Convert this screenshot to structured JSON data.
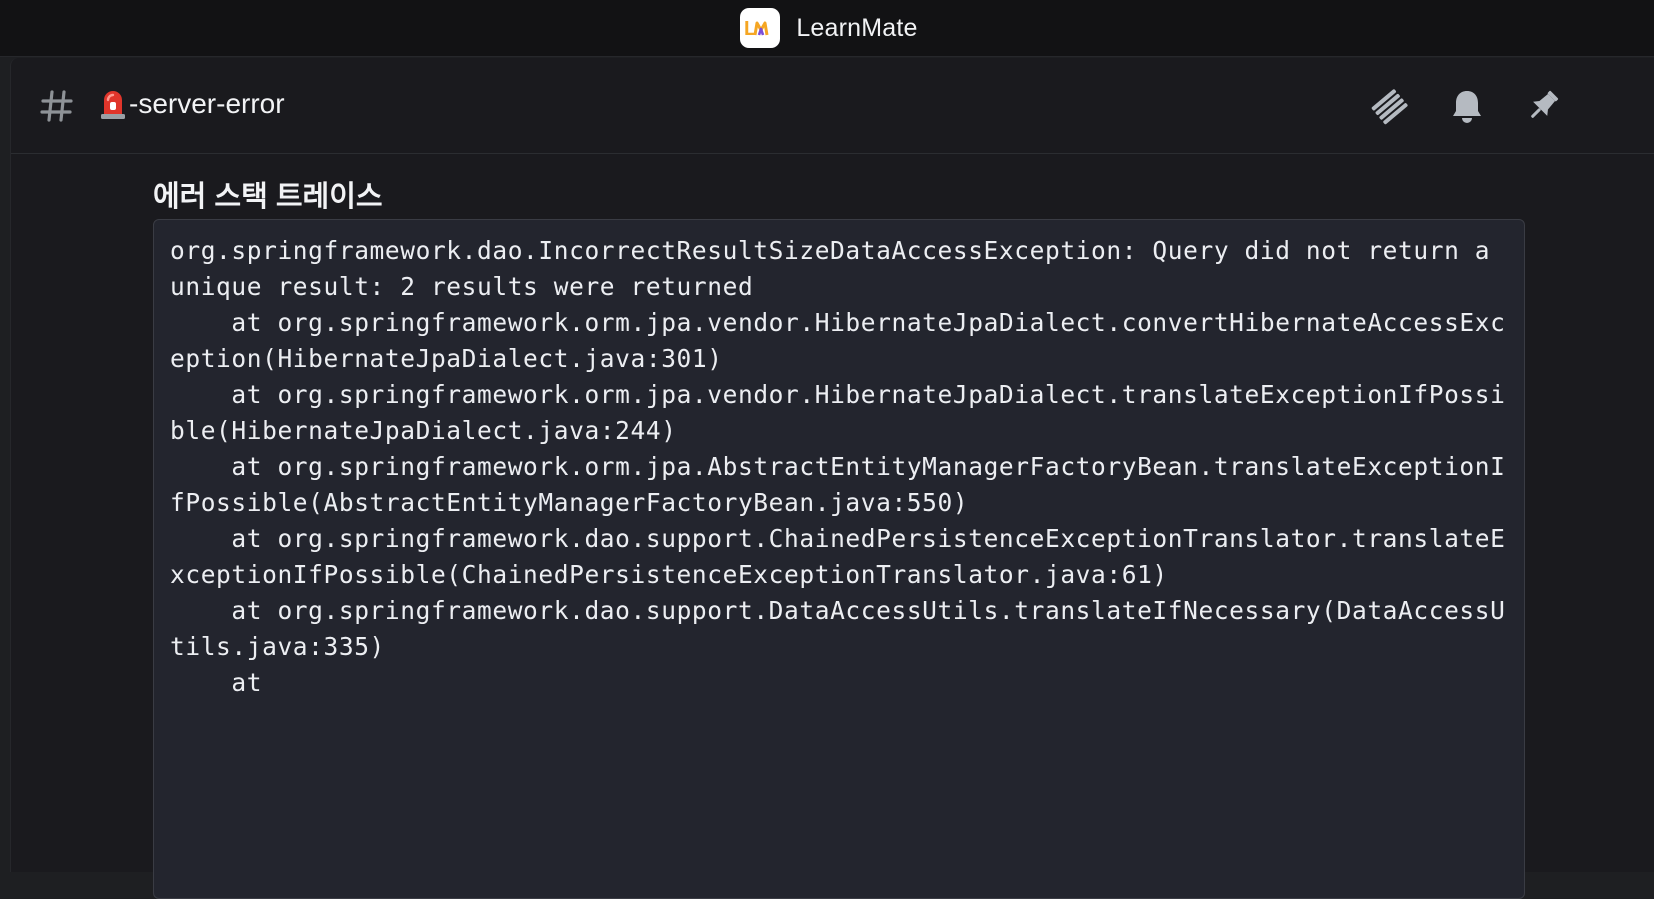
{
  "app": {
    "name": "LearnMate",
    "logo_text": "LM",
    "logo_colors": [
      "#f5a623",
      "#7b4dd6"
    ]
  },
  "channel": {
    "name": "-server-error",
    "prefix_icon": "hash-icon",
    "emoji_icon": "siren-icon"
  },
  "header_actions": [
    {
      "name": "threads",
      "icon": "threads-icon"
    },
    {
      "name": "notifications",
      "icon": "bell-icon"
    },
    {
      "name": "pinned",
      "icon": "pin-icon"
    }
  ],
  "message": {
    "section_title": "에러 스택 트레이스",
    "stack_trace": "org.springframework.dao.IncorrectResultSizeDataAccessException: Query did not return a unique result: 2 results were returned\n    at org.springframework.orm.jpa.vendor.HibernateJpaDialect.convertHibernateAccessException(HibernateJpaDialect.java:301)\n    at org.springframework.orm.jpa.vendor.HibernateJpaDialect.translateExceptionIfPossible(HibernateJpaDialect.java:244)\n    at org.springframework.orm.jpa.AbstractEntityManagerFactoryBean.translateExceptionIfPossible(AbstractEntityManagerFactoryBean.java:550)\n    at org.springframework.dao.support.ChainedPersistenceExceptionTranslator.translateExceptionIfPossible(ChainedPersistenceExceptionTranslator.java:61)\n    at org.springframework.dao.support.DataAccessUtils.translateIfNecessary(DataAccessUtils.java:335)\n    at"
  },
  "colors": {
    "background": "#1a1a1e",
    "titlebar": "#121214",
    "code_bg": "#23252e",
    "text": "#f2f3f5",
    "icon": "#b5bac1",
    "siren_red": "#e0352b"
  }
}
